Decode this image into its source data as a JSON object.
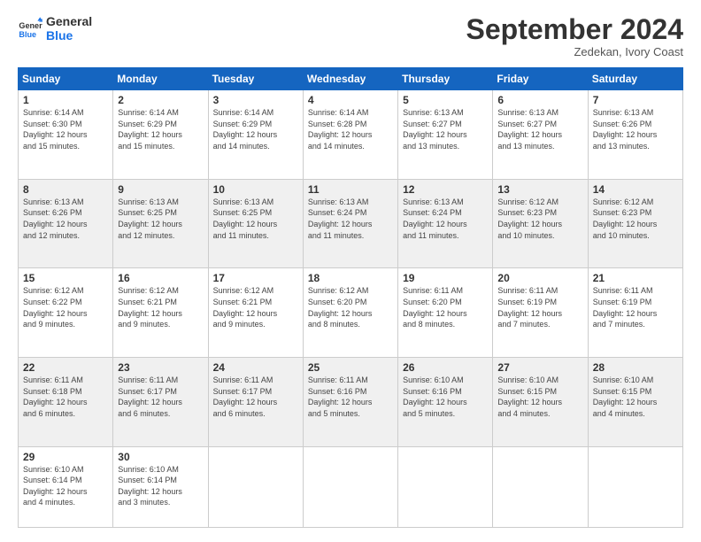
{
  "logo": {
    "line1": "General",
    "line2": "Blue"
  },
  "header": {
    "month": "September 2024",
    "location": "Zedekan, Ivory Coast"
  },
  "days": [
    "Sunday",
    "Monday",
    "Tuesday",
    "Wednesday",
    "Thursday",
    "Friday",
    "Saturday"
  ],
  "weeks": [
    [
      {
        "num": "1",
        "sunrise": "6:14 AM",
        "sunset": "6:30 PM",
        "daylight": "12 hours and 15 minutes."
      },
      {
        "num": "2",
        "sunrise": "6:14 AM",
        "sunset": "6:29 PM",
        "daylight": "12 hours and 15 minutes."
      },
      {
        "num": "3",
        "sunrise": "6:14 AM",
        "sunset": "6:29 PM",
        "daylight": "12 hours and 14 minutes."
      },
      {
        "num": "4",
        "sunrise": "6:14 AM",
        "sunset": "6:28 PM",
        "daylight": "12 hours and 14 minutes."
      },
      {
        "num": "5",
        "sunrise": "6:13 AM",
        "sunset": "6:27 PM",
        "daylight": "12 hours and 13 minutes."
      },
      {
        "num": "6",
        "sunrise": "6:13 AM",
        "sunset": "6:27 PM",
        "daylight": "12 hours and 13 minutes."
      },
      {
        "num": "7",
        "sunrise": "6:13 AM",
        "sunset": "6:26 PM",
        "daylight": "12 hours and 13 minutes."
      }
    ],
    [
      {
        "num": "8",
        "sunrise": "6:13 AM",
        "sunset": "6:26 PM",
        "daylight": "12 hours and 12 minutes."
      },
      {
        "num": "9",
        "sunrise": "6:13 AM",
        "sunset": "6:25 PM",
        "daylight": "12 hours and 12 minutes."
      },
      {
        "num": "10",
        "sunrise": "6:13 AM",
        "sunset": "6:25 PM",
        "daylight": "12 hours and 11 minutes."
      },
      {
        "num": "11",
        "sunrise": "6:13 AM",
        "sunset": "6:24 PM",
        "daylight": "12 hours and 11 minutes."
      },
      {
        "num": "12",
        "sunrise": "6:13 AM",
        "sunset": "6:24 PM",
        "daylight": "12 hours and 11 minutes."
      },
      {
        "num": "13",
        "sunrise": "6:12 AM",
        "sunset": "6:23 PM",
        "daylight": "12 hours and 10 minutes."
      },
      {
        "num": "14",
        "sunrise": "6:12 AM",
        "sunset": "6:23 PM",
        "daylight": "12 hours and 10 minutes."
      }
    ],
    [
      {
        "num": "15",
        "sunrise": "6:12 AM",
        "sunset": "6:22 PM",
        "daylight": "12 hours and 9 minutes."
      },
      {
        "num": "16",
        "sunrise": "6:12 AM",
        "sunset": "6:21 PM",
        "daylight": "12 hours and 9 minutes."
      },
      {
        "num": "17",
        "sunrise": "6:12 AM",
        "sunset": "6:21 PM",
        "daylight": "12 hours and 9 minutes."
      },
      {
        "num": "18",
        "sunrise": "6:12 AM",
        "sunset": "6:20 PM",
        "daylight": "12 hours and 8 minutes."
      },
      {
        "num": "19",
        "sunrise": "6:11 AM",
        "sunset": "6:20 PM",
        "daylight": "12 hours and 8 minutes."
      },
      {
        "num": "20",
        "sunrise": "6:11 AM",
        "sunset": "6:19 PM",
        "daylight": "12 hours and 7 minutes."
      },
      {
        "num": "21",
        "sunrise": "6:11 AM",
        "sunset": "6:19 PM",
        "daylight": "12 hours and 7 minutes."
      }
    ],
    [
      {
        "num": "22",
        "sunrise": "6:11 AM",
        "sunset": "6:18 PM",
        "daylight": "12 hours and 6 minutes."
      },
      {
        "num": "23",
        "sunrise": "6:11 AM",
        "sunset": "6:17 PM",
        "daylight": "12 hours and 6 minutes."
      },
      {
        "num": "24",
        "sunrise": "6:11 AM",
        "sunset": "6:17 PM",
        "daylight": "12 hours and 6 minutes."
      },
      {
        "num": "25",
        "sunrise": "6:11 AM",
        "sunset": "6:16 PM",
        "daylight": "12 hours and 5 minutes."
      },
      {
        "num": "26",
        "sunrise": "6:10 AM",
        "sunset": "6:16 PM",
        "daylight": "12 hours and 5 minutes."
      },
      {
        "num": "27",
        "sunrise": "6:10 AM",
        "sunset": "6:15 PM",
        "daylight": "12 hours and 4 minutes."
      },
      {
        "num": "28",
        "sunrise": "6:10 AM",
        "sunset": "6:15 PM",
        "daylight": "12 hours and 4 minutes."
      }
    ],
    [
      {
        "num": "29",
        "sunrise": "6:10 AM",
        "sunset": "6:14 PM",
        "daylight": "12 hours and 4 minutes."
      },
      {
        "num": "30",
        "sunrise": "6:10 AM",
        "sunset": "6:14 PM",
        "daylight": "12 hours and 3 minutes."
      },
      null,
      null,
      null,
      null,
      null
    ]
  ],
  "labels": {
    "sunrise": "Sunrise:",
    "sunset": "Sunset:",
    "daylight": "Daylight:"
  }
}
